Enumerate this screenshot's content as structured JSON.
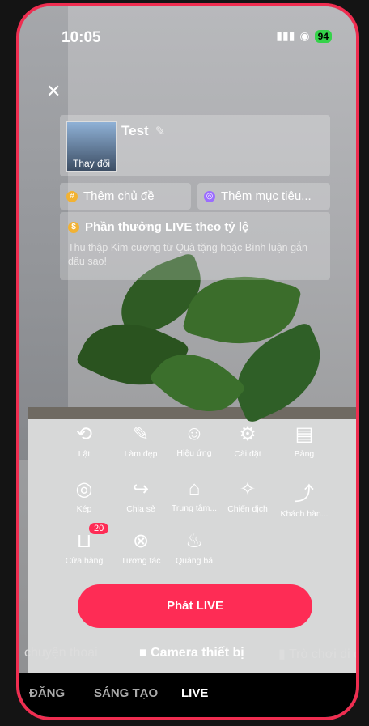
{
  "status": {
    "time": "10:05",
    "battery": "94"
  },
  "title": {
    "text": "Test",
    "thumb_label": "Thay đổi"
  },
  "topics": {
    "add_topic": "Thêm chủ đề",
    "add_goal": "Thêm mục tiêu..."
  },
  "reward": {
    "title": "Phần thưởng LIVE theo tỷ lệ",
    "desc": "Thu thập Kim cương từ Quà tặng hoặc Bình luận gắn dấu sao!"
  },
  "tools_row1": [
    {
      "label": "Lật",
      "icon": "flip-camera-icon"
    },
    {
      "label": "Làm đẹp",
      "icon": "beauty-wand-icon"
    },
    {
      "label": "Hiệu ứng",
      "icon": "effects-face-icon"
    },
    {
      "label": "Cài đặt",
      "icon": "settings-gear-icon"
    },
    {
      "label": "Bảng",
      "icon": "board-icon"
    }
  ],
  "tools_row2": [
    {
      "label": "Kép",
      "icon": "dual-camera-icon"
    },
    {
      "label": "Chia sẻ",
      "icon": "share-arrow-icon"
    },
    {
      "label": "Trung tâm...",
      "icon": "center-house-icon"
    },
    {
      "label": "Chiến dịch",
      "icon": "campaign-icon"
    },
    {
      "label": "Khách hàn...",
      "icon": "customer-growth-icon"
    }
  ],
  "tools_row3": [
    {
      "label": "Cửa hàng",
      "icon": "shop-bag-icon",
      "badge": "20"
    },
    {
      "label": "Tương tác",
      "icon": "interaction-icon"
    },
    {
      "label": "Quảng bá",
      "icon": "promote-flame-icon"
    }
  ],
  "live_button": "Phát LIVE",
  "modes": {
    "left": "chuyện thoại",
    "center": "Camera thiết bị",
    "right": "Trò chơi di đ"
  },
  "bottom_tabs": {
    "post": "ĐĂNG",
    "create": "SÁNG TẠO",
    "live": "LIVE"
  }
}
